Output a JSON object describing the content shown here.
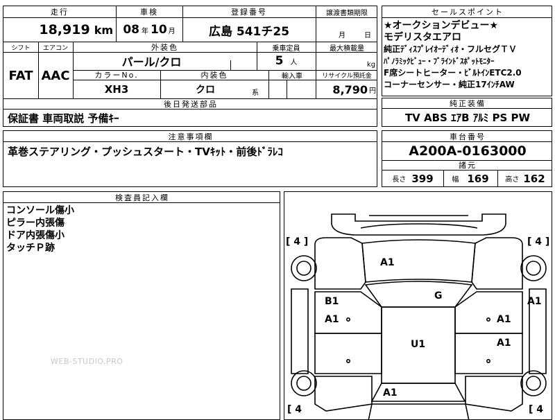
{
  "top_header": {
    "mileage_label": "走行",
    "inspection_label": "車検",
    "registration_label": "登録番号",
    "transfer_label": "譲渡書類期限",
    "mileage_value": "18,919",
    "mileage_unit": "km",
    "inspection_year": "08",
    "year_unit": "年",
    "inspection_month": "10",
    "month_unit": "月",
    "registration_value": "広島 541チ25",
    "transfer_month_unit": "月",
    "transfer_day_unit": "日"
  },
  "row2": {
    "shift_label": "シフト",
    "aircon_label": "エアコン",
    "exterior_label": "外装色",
    "capacity_label": "乗車定員",
    "max_load_label": "最大積載量",
    "shift_value": "FAT",
    "aircon_value": "AAC",
    "exterior_value": "パール/クロ",
    "capacity_value": "5",
    "capacity_unit": "人",
    "load_unit": "kg",
    "color_no_label": "カラーNo.",
    "interior_label": "内装色",
    "import_label": "輸入車",
    "recycle_label": "リサイクル預託金",
    "color_no_value": "XH3",
    "interior_value": "クロ",
    "interior_unit": "系",
    "recycle_value": "8,790",
    "recycle_unit": "円"
  },
  "later_parts": {
    "label": "後日発送部品",
    "value": "保証書 車両取説 予備ｷｰ"
  },
  "notes": {
    "label": "注意事項欄",
    "value": "革巻ステアリング・プッシュスタート・TVｷｯﾄ・前後ﾄﾞﾗﾚｺ"
  },
  "sales_points": {
    "label": "セールスポイント",
    "lines": [
      "★オークションデビュー★",
      "モデリスタエアロ",
      "純正ﾃﾞｨｽﾌﾟﾚｲｵｰﾃﾞｨｵ・フルセグＴＶ",
      "ﾊﾟﾉﾗﾐｯｸﾋﾞｭｰ・ﾌﾞﾗｲﾝﾄﾞｽﾎﾟｯﾄﾓﾆﾀｰ",
      "F席シートヒーター・ﾋﾞﾙﾄｲﾝETC2.0",
      "コーナーセンサー・純正17ｲﾝﾁAW"
    ]
  },
  "equipment": {
    "label": "純正装備",
    "value": "TV ABS ｴｱB ｱﾙﾐ PS PW"
  },
  "chassis": {
    "label": "車台番号",
    "value": "A200A-0163000"
  },
  "specs": {
    "label": "諸元",
    "length_label": "長さ",
    "length_value": "399",
    "width_label": "幅",
    "width_value": "169",
    "height_label": "高さ",
    "height_value": "162"
  },
  "inspector": {
    "label": "検査員記入欄",
    "lines": [
      "コンソール傷小",
      "ピラー内張傷",
      "ドア内張傷小",
      "タッチＰ跡"
    ]
  },
  "watermark": "WEB-STUDIO.PRO",
  "diagram": {
    "tire_tl": "[ 4 ]",
    "tire_tr": "[ 4 ]",
    "tire_bl": "[ 4",
    "tire_br": "[ 4",
    "marks": {
      "hood": "A1",
      "windshield": "G",
      "left_front_fender_b": "B1",
      "left_front_fender_a": "A1",
      "right_fender": "A1",
      "right_front_door": "A1",
      "right_rear_door": "A1",
      "roof": "U1",
      "rear": "A1"
    }
  }
}
